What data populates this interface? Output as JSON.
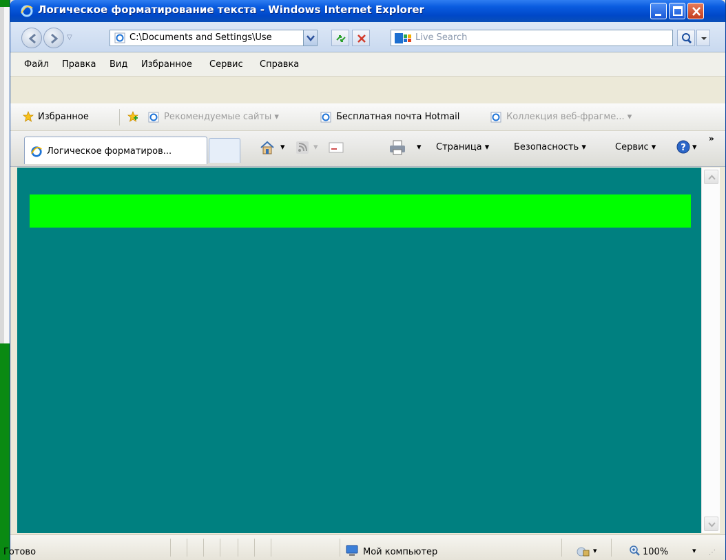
{
  "window": {
    "title": "Логическое форматирование текста - Windows Internet Explorer"
  },
  "address": {
    "url": "C:\\Documents and Settings\\Use",
    "search_placeholder": "Live Search"
  },
  "menu": {
    "items": [
      "Файл",
      "Правка",
      "Вид",
      "Избранное",
      "Сервис",
      "Справка"
    ]
  },
  "favorites": {
    "label": "Избранное",
    "links": [
      "Рекомендуемые сайты ▾",
      "Бесплатная почта Hotmail",
      "Коллекция веб-фрагме...  ▾"
    ]
  },
  "tabs": {
    "active_label": "Логическое форматиров..."
  },
  "commands": {
    "page": "Страница ▾",
    "safety": "Безопасность ▾",
    "tools": "Сервис ▾",
    "overflow": "»"
  },
  "status": {
    "text": "Готово",
    "zone": "Мой компьютер",
    "zoom": "100%"
  },
  "colors": {
    "content_bg": "#008080",
    "strip": "#00ff00",
    "desktop_bg": "#0a8a12"
  }
}
